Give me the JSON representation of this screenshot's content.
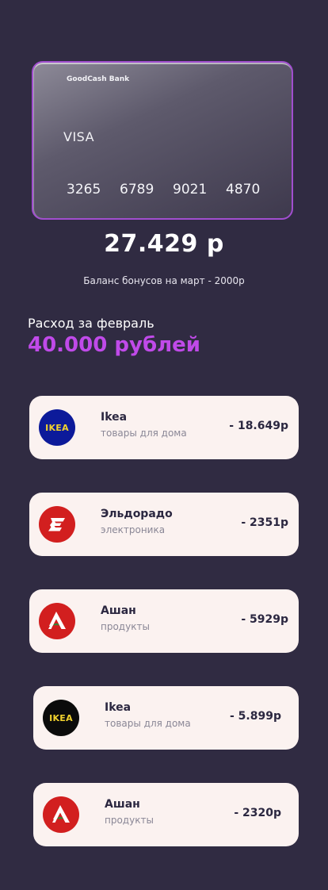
{
  "card": {
    "bank_name": "GoodCash Bank",
    "brand": "VISA",
    "number_groups": [
      "3265",
      "6789",
      "9021",
      "4870"
    ]
  },
  "balance": {
    "amount": "27.429 р",
    "bonus_text": "Баланс бонусов на март - 2000р"
  },
  "expenses": {
    "label": "Расход за февраль",
    "amount": "40.000 рублей"
  },
  "transactions": [
    {
      "name": "Ikea",
      "category": "товары для дома",
      "amount": "- 18.649р",
      "logo_text": "IKEA",
      "icon": "ikea-logo-icon"
    },
    {
      "name": "Эльдорадо",
      "category": "электроника",
      "amount": "- 2351р",
      "icon": "eldorado-logo-icon"
    },
    {
      "name": "Ашан",
      "category": "продукты",
      "amount": "- 5929р",
      "icon": "auchan-logo-icon"
    },
    {
      "name": "Ikea",
      "category": "товары для дома",
      "amount": "- 5.899р",
      "logo_text": "IKEA",
      "icon": "ikea-logo-icon"
    },
    {
      "name": "Ашан",
      "category": "продукты",
      "amount": "- 2320р",
      "icon": "auchan-logo-icon"
    }
  ],
  "colors": {
    "background": "#302b42",
    "accent": "#c04ae9",
    "card_border": "#a14ecf",
    "item_background": "#fbf2f0"
  }
}
